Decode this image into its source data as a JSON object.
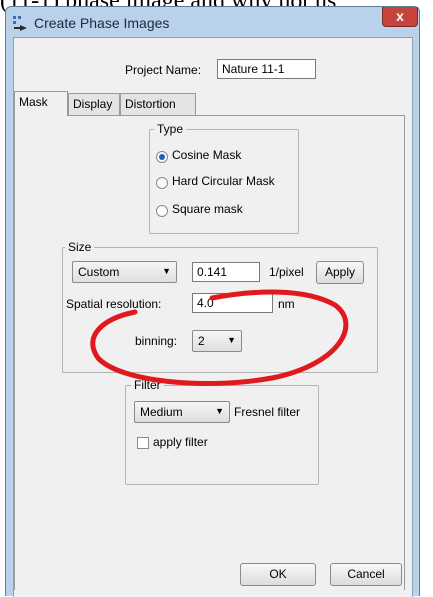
{
  "page": {
    "partial_heading_text": "(11-1) phase image and why not us"
  },
  "window": {
    "title": "Create Phase Images",
    "close_label": "x"
  },
  "project": {
    "label": "Project Name:",
    "value": "Nature 11-1"
  },
  "tabs": [
    {
      "label": "Mask",
      "active": true
    },
    {
      "label": "Display",
      "active": false
    },
    {
      "label": "Distortion",
      "active": false
    }
  ],
  "type_group": {
    "title": "Type",
    "options": [
      {
        "label": "Cosine Mask",
        "selected": true
      },
      {
        "label": "Hard Circular Mask",
        "selected": false
      },
      {
        "label": "Square mask",
        "selected": false
      }
    ]
  },
  "size_group": {
    "title": "Size",
    "mode_value": "Custom",
    "pixel_value": "0.141",
    "pixel_unit": "1/pixel",
    "apply_label": "Apply",
    "spatial_label": "Spatial resolution:",
    "spatial_value": "4.0",
    "spatial_unit": "nm",
    "binning_label": "binning:",
    "binning_value": "2"
  },
  "filter_group": {
    "title": "Filter",
    "strength_value": "Medium",
    "filter_type": "Fresnel filter",
    "apply_filter_label": "apply filter",
    "apply_filter_checked": false
  },
  "buttons": {
    "ok": "OK",
    "cancel": "Cancel"
  },
  "annotation": {
    "color": "#e0191f"
  }
}
